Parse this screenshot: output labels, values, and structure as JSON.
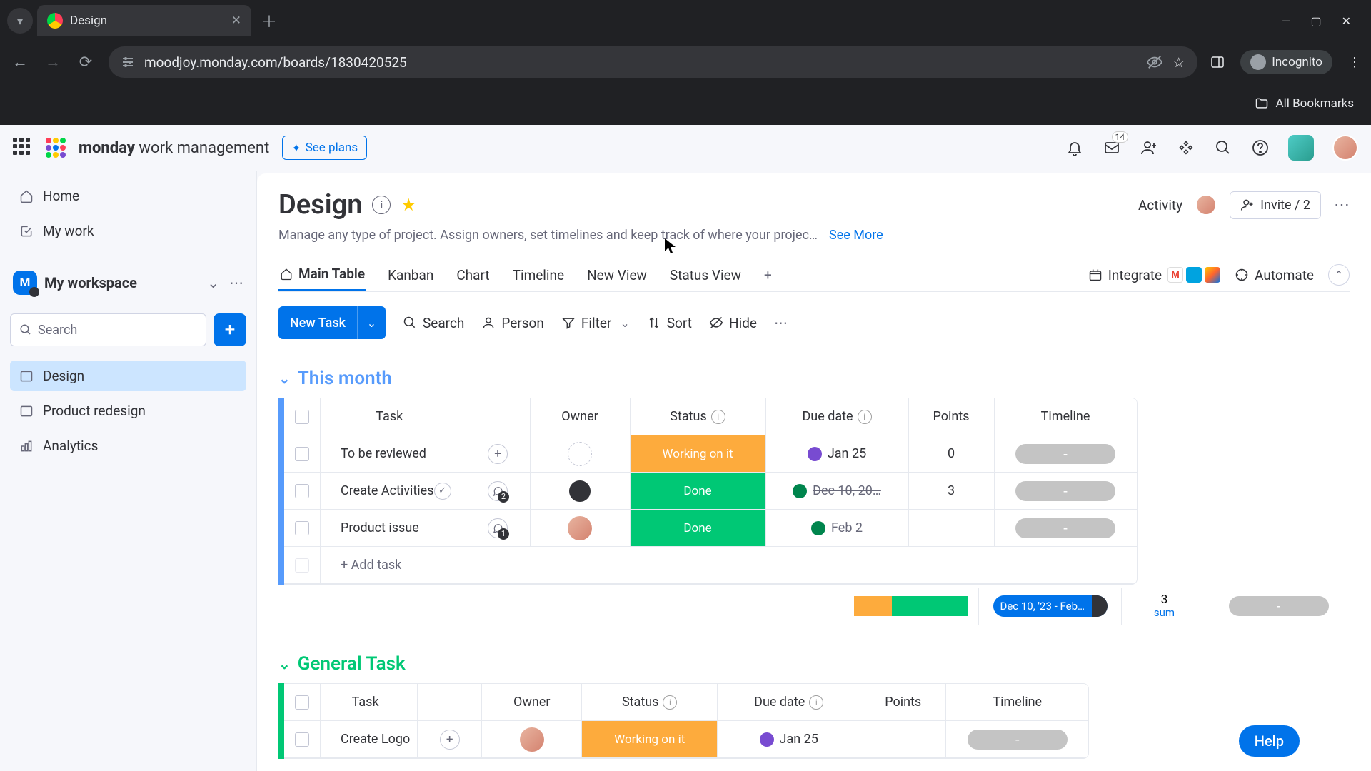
{
  "browser": {
    "tab_title": "Design",
    "url": "moodjoy.monday.com/boards/1830420525",
    "incognito": "Incognito",
    "bookmarks_label": "All Bookmarks"
  },
  "top": {
    "brand_bold": "monday",
    "brand_rest": " work management",
    "see_plans": "See plans",
    "inbox_badge": "14"
  },
  "sidebar": {
    "home": "Home",
    "mywork": "My work",
    "workspace": "My workspace",
    "search_placeholder": "Search",
    "boards": [
      {
        "label": "Design"
      },
      {
        "label": "Product redesign"
      },
      {
        "label": "Analytics"
      }
    ]
  },
  "board": {
    "title": "Design",
    "desc": "Manage any type of project. Assign owners, set timelines and keep track of where your projec…",
    "seemore": "See More",
    "activity": "Activity",
    "invite": "Invite / 2",
    "tabs": {
      "main": "Main Table",
      "kanban": "Kanban",
      "chart": "Chart",
      "timeline": "Timeline",
      "newview": "New View",
      "status": "Status View"
    },
    "integrate": "Integrate",
    "automate": "Automate"
  },
  "toolbar": {
    "newtask": "New Task",
    "search": "Search",
    "person": "Person",
    "filter": "Filter",
    "sort": "Sort",
    "hide": "Hide"
  },
  "columns": {
    "task": "Task",
    "owner": "Owner",
    "status": "Status",
    "due": "Due date",
    "points": "Points",
    "timeline": "Timeline"
  },
  "groups": [
    {
      "name": "This month",
      "color": "blue",
      "rows": [
        {
          "task": "To be reviewed",
          "tick": false,
          "bubble": null,
          "plus": true,
          "owner": "placeholder",
          "status": "Working on it",
          "status_cls": "st-work",
          "due": "Jan 25",
          "due_strike": false,
          "due_ico": "di-time",
          "points": "0",
          "timeline": "-"
        },
        {
          "task": "Create Activities",
          "tick": true,
          "bubble": "2",
          "plus": false,
          "owner": "dark",
          "status": "Done",
          "status_cls": "st-done",
          "due": "Dec 10, 20…",
          "due_strike": true,
          "due_ico": "di-warn",
          "points": "3",
          "timeline": "-"
        },
        {
          "task": "Product issue",
          "tick": false,
          "bubble": "1",
          "plus": false,
          "owner": "photo",
          "status": "Done",
          "status_cls": "st-done",
          "due": "Feb 2",
          "due_strike": true,
          "due_ico": "di-ok",
          "points": "",
          "timeline": "-"
        }
      ],
      "add": "+ Add task",
      "summary": {
        "due": "Dec 10, '23 - Feb…",
        "points": "3",
        "points_lbl": "sum",
        "timeline": "-"
      }
    },
    {
      "name": "General Task",
      "color": "green",
      "rows": [
        {
          "task": "Create Logo",
          "tick": false,
          "bubble": null,
          "plus": true,
          "owner": "photo",
          "status": "Working on it",
          "status_cls": "st-work",
          "due": "Jan 25",
          "due_strike": false,
          "due_ico": "di-time",
          "points": "",
          "timeline": "-"
        }
      ]
    }
  ],
  "help": "Help"
}
